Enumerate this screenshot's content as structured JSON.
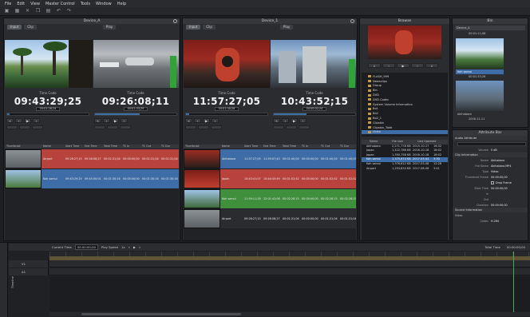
{
  "menu": [
    "File",
    "Edit",
    "View",
    "Master Control",
    "Tools",
    "Window",
    "Help"
  ],
  "player1": {
    "title": "Device_A",
    "tabs": [
      "Input",
      "Clip"
    ],
    "left": {
      "tc_label": "Time Code",
      "tc": "09:43:29;25",
      "small": "00:01:26;24"
    },
    "right": {
      "tc_label": "Time Code",
      "tc": "09:26:08;11",
      "small": "00:01:33;29"
    }
  },
  "player2": {
    "title": "Device_1",
    "tabs": [
      "Input",
      "Clip"
    ],
    "play_tab": "Play",
    "left": {
      "tc_label": "Time Code",
      "tc": "11:57:27;05",
      "small": "00:01:30;28"
    },
    "right": {
      "tc_label": "Time Code",
      "tc": "10:43:52;15",
      "small": "00:00:02;24"
    }
  },
  "play_label": "Play",
  "transport": [
    "«",
    "‹",
    "▶",
    "›",
    "»"
  ],
  "cliplist1": {
    "headers": [
      "Thumbnail",
      "Name",
      "Start Time",
      "End Time",
      "Total Time",
      "TC In",
      "TC Out",
      "TC Dur"
    ],
    "rows": [
      {
        "name": "Airport",
        "start": "09:26:27;15",
        "end": "09:26:08;27",
        "total": "00:01:31;04",
        "in": "00:00:00;00",
        "out": "00:01:31;04",
        "dur": "00:01:31;04",
        "color": "#b8433c"
      },
      {
        "name": "Koh samui",
        "start": "09:43:29;25",
        "end": "09:45:00;01",
        "total": "00:01:30;16",
        "in": "00:00:00;00",
        "out": "00:01:30;16",
        "dur": "00:01:30;16",
        "color": "#3d6ca6"
      }
    ]
  },
  "cliplist2": {
    "headers": [
      "Thumbnail",
      "Name",
      "Start Time",
      "End Time",
      "Total Time",
      "TC In",
      "TC Out",
      "TC Dur"
    ],
    "rows": [
      {
        "name": "Akihabara",
        "start": "11:57:27;05",
        "end": "11:59:07;43",
        "total": "00:01:40;05",
        "in": "00:00:00;00",
        "out": "00:01:40;05",
        "dur": "00:01:40;05",
        "color": "#3d6ca6"
      },
      {
        "name": "Japan",
        "start": "10:43:41;07",
        "end": "10:44:45;49",
        "total": "00:01:02;42",
        "in": "00:00:00;00",
        "out": "00:01:02;42",
        "dur": "00:01:02;42",
        "color": "#b8433c"
      },
      {
        "name": "Koh samui",
        "start": "11:59:11;28",
        "end": "12:01:42;06",
        "total": "00:02:28;15",
        "in": "00:00:00;00",
        "out": "00:02:28;15",
        "dur": "00:02:28;15",
        "color": "#3f8f3c"
      },
      {
        "name": "Airport",
        "start": "09:26:27;15",
        "end": "09:26:08;27",
        "total": "00:01:31;04",
        "in": "00:00:00;00",
        "out": "00:01:31;04",
        "dur": "00:01:31;04",
        "color": "#2b2c30"
      }
    ]
  },
  "browse": {
    "title": "Browse",
    "tree": [
      "FLASH_999",
      "Newsclips",
      "Group",
      "Bin",
      "DVD",
      "DVD Codec",
      "System Volume Information",
      "Bo1",
      "Bo2",
      "Bo2_1",
      "Clipsbin",
      "Clipsbin_Total",
      "Video"
    ],
    "files_hdr": [
      "Name",
      "File size",
      "Last Updated"
    ],
    "files": [
      {
        "name": "Akihabara",
        "size": "2,271,778 KB",
        "date": "2015-10-17",
        "time": "16:32",
        "sel": false
      },
      {
        "name": "Japan",
        "size": "1,422,786 KB",
        "date": "2016-10-18",
        "time": "18:02",
        "sel": false
      },
      {
        "name": "Japan",
        "size": "1,390,758 KB",
        "date": "2016-10-18",
        "time": "18:02",
        "sel": false
      },
      {
        "name": "Koh samui",
        "size": "1,375,674 KB",
        "date": "2017-03-04",
        "time": "3:30",
        "sel": true
      },
      {
        "name": "Koh samui",
        "size": "1,376,612 KB",
        "date": "2017-03-08",
        "time": "12:28",
        "sel": false
      },
      {
        "name": "Airport",
        "size": "1,293,834 KB",
        "date": "2017-08-06",
        "time": "3:41",
        "sel": false
      }
    ]
  },
  "bin": {
    "title": "Bin",
    "device": "Device_A",
    "tc1": "00:01:11;06",
    "clip1": "Koh samui",
    "tc1b": "00:01:33;26",
    "clip2": "Akihabara",
    "tc2": "2016-11-11"
  },
  "attr": {
    "title": "Attribute Bar",
    "audio_hdr": "Audio Attribute",
    "volume_k": "Volume",
    "volume_v": "0 dB",
    "clip_hdr": "Clip Information",
    "rows": [
      {
        "k": "Name",
        "v": "Akihabara"
      },
      {
        "k": "File Name",
        "v": "Akihabara.MP4"
      },
      {
        "k": "Type",
        "v": "Video"
      },
      {
        "k": "Thumbnail Frame",
        "v": "00:00:00;00"
      },
      {
        "k": "",
        "v": "Drop Frame"
      },
      {
        "k": "Start Time",
        "v": "00:00:00;00"
      },
      {
        "k": "In",
        "v": ""
      },
      {
        "k": "Out",
        "v": ""
      },
      {
        "k": "Duration",
        "v": "00:00:00;00"
      }
    ],
    "src_hdr": "Source Information",
    "src_sub": "Video",
    "codec_k": "Codec",
    "codec_v": "H.264"
  },
  "timeline": {
    "current_label": "Current Time",
    "current": "00:00:00;00",
    "speed_label": "Play Speed",
    "speed": "1x",
    "total_label": "Total Time",
    "total": "00:00:00;00",
    "tracks": [
      "V1",
      "A1"
    ],
    "side": "Timeline"
  }
}
